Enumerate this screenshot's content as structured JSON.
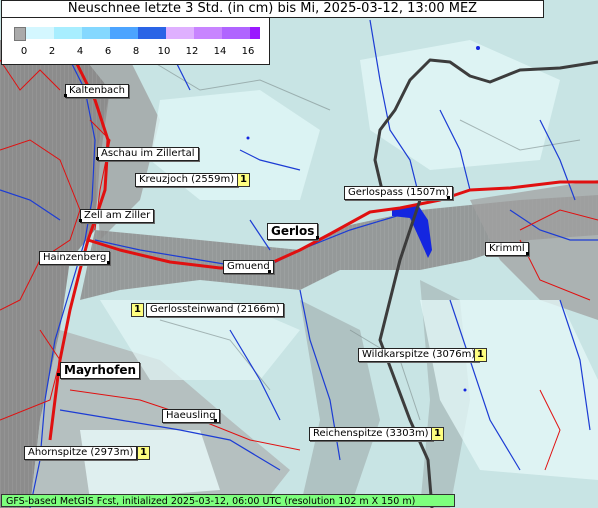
{
  "title": "Neuschnee letzte 3 Std. (in cm) bis Mi, 2025-03-12, 13:00 MEZ",
  "legend": {
    "ticks": [
      "0",
      "2",
      "4",
      "6",
      "8",
      "10",
      "12",
      "14",
      "16"
    ],
    "colors": [
      "#aaaaaa",
      "#d4f7ff",
      "#a8eeff",
      "#84d8ff",
      "#4ca4ff",
      "#2a64e6",
      "#dfb0ff",
      "#c884ff",
      "#b064ff",
      "#9a18ff"
    ]
  },
  "places": {
    "kaltenbach": "Kaltenbach",
    "aschau": "Aschau im Zillertal",
    "kreuzjoch": "Kreuzjoch (2559m)",
    "zell": "Zell am Ziller",
    "gerlospass": "Gerlospass (1507m)",
    "gerlos": "Gerlos",
    "krimml": "Krimml",
    "hainzenberg": "Hainzenberg",
    "gmuend": "Gmuend",
    "gerlossteinwand": "Gerlossteinwand (2166m)",
    "mayrhofen": "Mayrhofen",
    "wildkarspitze": "Wildkarspitze (3076m)",
    "haeusling": "Haeusling",
    "reichenspitze": "Reichenspitze (3303m)",
    "ahornspitze": "Ahornspitze (2973m)"
  },
  "snow_badges": {
    "kreuzjoch": "1",
    "gerlossteinwand": "1",
    "wildkarspitze": "1",
    "reichenspitze": "1",
    "ahornspitze": "1"
  },
  "footer": "GFS-based MetGIS Fcst, initialized 2025-03-12, 06:00 UTC  (resolution 102 m X 150 m)"
}
